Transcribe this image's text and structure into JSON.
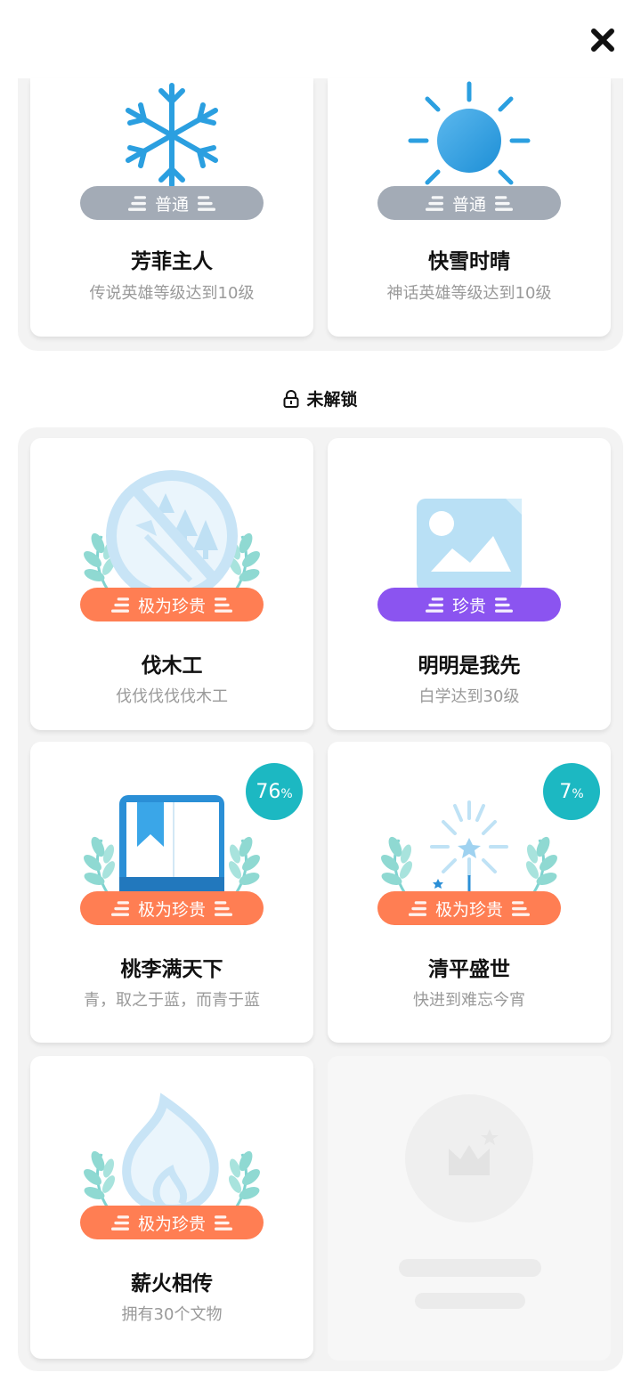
{
  "close_icon": "close-icon",
  "unlocked": [
    {
      "title": "芳菲主人",
      "desc": "传说英雄等级达到10级",
      "rarity": "普通",
      "icon": "snowflake-icon"
    },
    {
      "title": "快雪时晴",
      "desc": "神话英雄等级达到10级",
      "rarity": "普通",
      "icon": "sun-icon"
    }
  ],
  "locked_section": {
    "label": "未解锁",
    "icon": "lock-icon"
  },
  "locked": [
    {
      "title": "伐木工",
      "desc": "伐伐伐伐伐木工",
      "rarity": "极为珍贵",
      "icon": "no-logging-icon"
    },
    {
      "title": "明明是我先",
      "desc": "白学达到30级",
      "rarity": "珍贵",
      "icon": "image-icon"
    },
    {
      "title": "桃李满天下",
      "desc": "青，取之于蓝，而青于蓝",
      "rarity": "极为珍贵",
      "icon": "book-icon",
      "progress": "76",
      "progress_unit": "%"
    },
    {
      "title": "清平盛世",
      "desc": "快进到难忘今宵",
      "rarity": "极为珍贵",
      "icon": "fireworks-icon",
      "progress": "7",
      "progress_unit": "%"
    },
    {
      "title": "薪火相传",
      "desc": "拥有30个文物",
      "rarity": "极为珍贵",
      "icon": "flame-icon"
    }
  ],
  "colors": {
    "common": "#a3abb6",
    "epic": "#ff7e53",
    "rare": "#8b54f0",
    "progress": "#1cb8c2",
    "panel": "#f3f3f3"
  }
}
